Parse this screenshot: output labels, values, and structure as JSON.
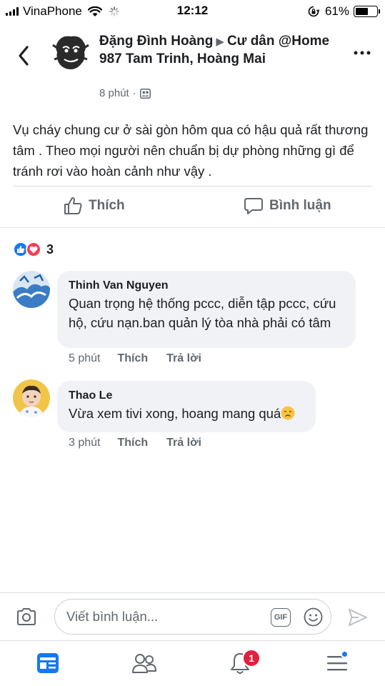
{
  "status_bar": {
    "carrier": "VinaPhone",
    "time": "12:12",
    "battery_percent": "61%",
    "battery_level": 0.61
  },
  "post": {
    "author": "Đặng Đình Hoàng",
    "target": "Cư dân @Home 987 Tam Trinh, Hoàng Mai",
    "time": "8 phút",
    "text": "Vụ cháy chung cư ở sài gòn hôm qua  có hậu quả rất thương tâm . Theo mọi người nên chuẩn bị dự phòng những gì để tránh rơi vào hoàn cảnh như vậy ."
  },
  "actions": {
    "like_label": "Thích",
    "comment_label": "Bình luận"
  },
  "reactions": {
    "count": "3"
  },
  "comments": [
    {
      "name": "Thinh Van Nguyen",
      "text": "Quan trọng hệ thống pccc, diễn tập pccc, cứu hộ, cứu nạn.ban quản lý tòa nhà phải có tâm",
      "time": "5 phút",
      "like": "Thích",
      "reply": "Trả lời"
    },
    {
      "name": "Thao Le",
      "text": "Vừa xem tivi xong, hoang mang quá",
      "time": "3 phút",
      "like": "Thích",
      "reply": "Trả lời"
    }
  ],
  "composer": {
    "placeholder": "Viết bình luận...",
    "gif_label": "GIF"
  },
  "tabbar": {
    "notifications_badge": "1"
  },
  "colors": {
    "accent": "#1877f2",
    "love": "#f33e58",
    "badge": "#e41e3f",
    "secondary_text": "#606770",
    "bubble": "#f0f2f5"
  },
  "icons": [
    "back-chevron-icon",
    "more-icon",
    "globe-group-icon",
    "like-icon",
    "comment-icon",
    "camera-icon",
    "gif-icon",
    "emoji-icon",
    "send-icon",
    "news-feed-icon",
    "friends-icon",
    "bell-icon",
    "menu-icon"
  ]
}
